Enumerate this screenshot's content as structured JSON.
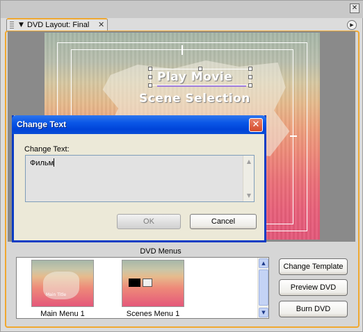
{
  "panel": {
    "tab_title": "DVD Layout: Final",
    "tab_close": "✕",
    "close": "✕",
    "menu_btn": "▶"
  },
  "canvas": {
    "menu_items": [
      "Play Movie",
      "Scene Selection"
    ]
  },
  "dialog": {
    "title": "Change Text",
    "close": "✕",
    "field_label": "Change Text:",
    "field_value": "Фильм",
    "ok_label": "OK",
    "cancel_label": "Cancel",
    "ok_enabled": false
  },
  "dvd_menus": {
    "label": "DVD Menus",
    "items": [
      {
        "label": "Main Menu 1",
        "thumb_text": "Main Title"
      },
      {
        "label": "Scenes Menu 1"
      }
    ]
  },
  "buttons": {
    "change_template": "Change Template",
    "preview_dvd": "Preview DVD",
    "burn_dvd": "Burn DVD"
  },
  "colors": {
    "dialog_titlebar": "#0a56e6",
    "panel_accent": "#f0a830"
  }
}
